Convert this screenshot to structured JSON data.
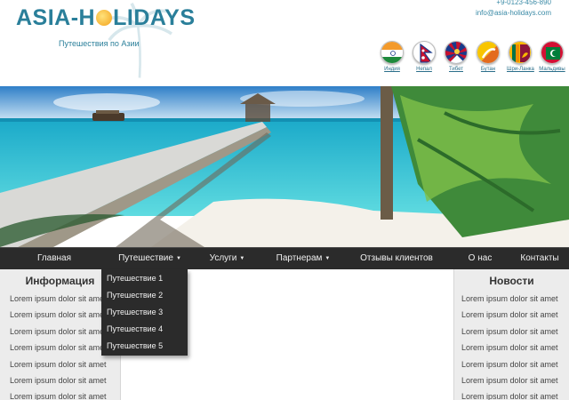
{
  "header": {
    "logo_text_left": "ASIA-H",
    "logo_text_right": "LIDAYS",
    "tagline": "Путешествия по Азии",
    "contact_phone": "+9-0123-456-890",
    "contact_email": "info@asia-holidays.com"
  },
  "flags": [
    {
      "label": "Индия",
      "icon": "india-flag-icon"
    },
    {
      "label": "Непал",
      "icon": "nepal-flag-icon"
    },
    {
      "label": "Тибет",
      "icon": "tibet-flag-icon"
    },
    {
      "label": "Бутан",
      "icon": "bhutan-flag-icon"
    },
    {
      "label": "Шри-Ланка",
      "icon": "sri-lanka-flag-icon"
    },
    {
      "label": "Мальдивы",
      "icon": "maldives-flag-icon"
    }
  ],
  "nav": {
    "items": [
      {
        "label": "Главная",
        "has_caret": false
      },
      {
        "label": "Путешествие",
        "has_caret": true
      },
      {
        "label": "Услуги",
        "has_caret": true
      },
      {
        "label": "Партнерам",
        "has_caret": true
      },
      {
        "label": "Отзывы клиентов",
        "has_caret": false
      },
      {
        "label": "О нас",
        "has_caret": false
      },
      {
        "label": "Контакты",
        "has_caret": false
      }
    ],
    "caret_glyph": "▼"
  },
  "dropdown": {
    "items": [
      "Путешествие 1",
      "Путешествие 2",
      "Путешествие 3",
      "Путешествие 4",
      "Путешествие 5"
    ]
  },
  "left_column": {
    "title": "Информация",
    "items": [
      "Lorem ipsum dolor sit amet",
      "Lorem ipsum dolor sit amet",
      "Lorem ipsum dolor sit amet",
      "Lorem ipsum dolor sit amet",
      "Lorem ipsum dolor sit amet",
      "Lorem ipsum dolor sit amet",
      "Lorem ipsum dolor sit amet"
    ]
  },
  "right_column": {
    "title": "Новости",
    "items": [
      "Lorem ipsum dolor sit amet",
      "Lorem ipsum dolor sit amet",
      "Lorem ipsum dolor sit amet",
      "Lorem ipsum dolor sit amet",
      "Lorem ipsum dolor sit amet",
      "Lorem ipsum dolor sit amet",
      "Lorem ipsum dolor sit amet"
    ]
  },
  "colors": {
    "brand": "#2a7f9a",
    "nav_bg": "#2b2b2b",
    "sidebar_bg": "#ececec"
  }
}
